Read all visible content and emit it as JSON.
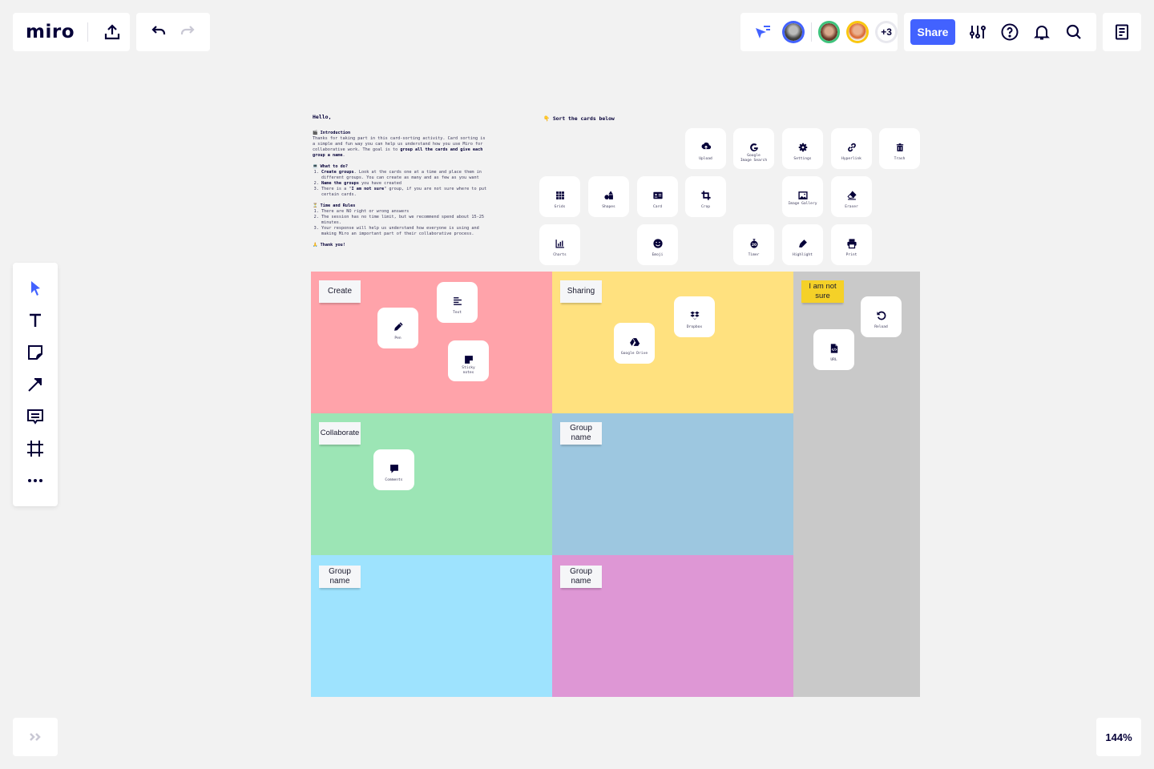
{
  "toolbar": {
    "logo": "miro",
    "zoom_level": "144%",
    "share_label": "Share",
    "more_users": "+3",
    "collaborators": [
      {
        "name": "collaborator-1",
        "ring": "#4262ff"
      },
      {
        "name": "collaborator-2",
        "ring": "#3fc37c"
      },
      {
        "name": "collaborator-3",
        "ring": "#fac710"
      }
    ]
  },
  "left_tools": [
    "select",
    "text",
    "sticky-note",
    "arrow",
    "comment",
    "frame",
    "more"
  ],
  "instructions": {
    "greeting": "Hello,",
    "intro_title": "Introduction",
    "intro_text_1": "Thanks for taking part in this card-sorting activity. Card sorting is a simple and fun way you can help us understand how you use Miro for collaborative work. The goal is to ",
    "intro_bold": "group all the cards and give each group a name",
    "intro_end": ".",
    "todo_title": "What to do?",
    "todo_1_bold": "Create groups",
    "todo_1": ". Look at the cards one at a time and place them in different groups. You can create as many and as few as you want",
    "todo_2_bold": "Name the groups",
    "todo_2": " you have created",
    "todo_3_pre": "There is a \"",
    "todo_3_bold": "I am not sure",
    "todo_3": "\" group, if you are not sure where to put certain cards.",
    "rules_title": "Time and Rules",
    "rule_1": "There are NO right or wrong answers",
    "rule_2": "The session has no time limit, but we recommend spend about 15-25 minutes.",
    "rule_3": "Your response will help us understand how everyone is using and making Miro an important part of their collaborative process.",
    "thanks": "Thank you!"
  },
  "sort_title": "Sort the cards below",
  "unsorted_cards": [
    {
      "label": "Upload",
      "icon": "upload-cloud"
    },
    {
      "label": "Google Image Search",
      "icon": "google"
    },
    {
      "label": "Settings",
      "icon": "gear"
    },
    {
      "label": "Hyperlink",
      "icon": "link"
    },
    {
      "label": "Trash",
      "icon": "trash"
    },
    {
      "label": "Grids",
      "icon": "grid"
    },
    {
      "label": "Shapes",
      "icon": "shapes"
    },
    {
      "label": "Card",
      "icon": "card"
    },
    {
      "label": "Crop",
      "icon": "crop"
    },
    {
      "label": "Image Gallery",
      "icon": "image"
    },
    {
      "label": "Eraser",
      "icon": "eraser"
    },
    {
      "label": "Charts",
      "icon": "chart"
    },
    {
      "label": "Emoji",
      "icon": "emoji"
    },
    {
      "label": "Timer",
      "icon": "timer"
    },
    {
      "label": "Highlight",
      "icon": "highlighter"
    },
    {
      "label": "Print",
      "icon": "print"
    }
  ],
  "groups": [
    {
      "name": "Create",
      "color": "#ffa3aa",
      "cards": [
        {
          "label": "Text",
          "icon": "text"
        },
        {
          "label": "Pen",
          "icon": "pen"
        },
        {
          "label": "Sticky notes",
          "icon": "sticky"
        }
      ]
    },
    {
      "name": "Sharing",
      "color": "#ffe17f",
      "cards": [
        {
          "label": "Dropbox",
          "icon": "dropbox"
        },
        {
          "label": "Google Drive",
          "icon": "drive"
        }
      ]
    },
    {
      "name": "I am not sure",
      "color": "#c9c9c9",
      "cards": [
        {
          "label": "Reload",
          "icon": "reload"
        },
        {
          "label": "URL",
          "icon": "code-file"
        }
      ]
    },
    {
      "name": "Collaborate",
      "color": "#9ce5b5",
      "cards": [
        {
          "label": "Comments",
          "icon": "comment"
        }
      ]
    },
    {
      "name": "Group name",
      "color": "#9dc7e0",
      "cards": []
    },
    {
      "name": "Group name",
      "color": "#9ee3fe",
      "cards": []
    },
    {
      "name": "Group name",
      "color": "#de97d5",
      "cards": []
    }
  ]
}
